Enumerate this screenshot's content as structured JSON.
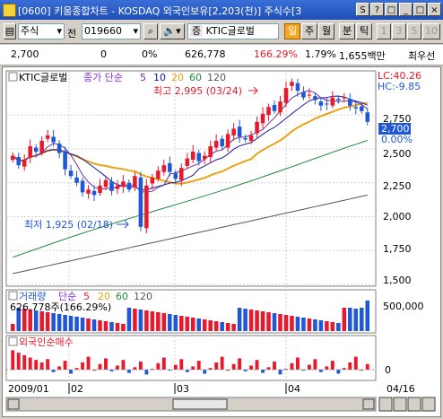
{
  "window": {
    "title": "[0600] 키움종합차트 - KOSDAQ 외국인보유[2,203(천)] 주식수[3",
    "buttons": [
      "S",
      "?",
      "□",
      "_",
      "□",
      "×"
    ]
  },
  "toolbar": {
    "market_label": "주식",
    "prev_label": "전",
    "code_value": "019660",
    "search_icon": "search-icon",
    "speaker_icon": "speaker-icon",
    "stock_badge": "증",
    "stock_name": "KTIC글로벌",
    "periods": [
      "일",
      "주",
      "월",
      "분",
      "틱"
    ],
    "active_period": "일",
    "intervals": [
      "1",
      "3",
      "5",
      "10"
    ]
  },
  "info": {
    "price": "2,700",
    "change": "0",
    "change_pct": "0%",
    "volume": "626,778",
    "volume_ratio": "166.29%",
    "turnover": "1.79%",
    "amount": "1,655백만",
    "priority": "최우선"
  },
  "price_panel": {
    "legend_name": "KTIC글로벌",
    "legend_ma_label": "종가 단순",
    "legend_ma": [
      "5",
      "10",
      "20",
      "60",
      "120"
    ],
    "lc_label": "LC:40.26",
    "hc_label": "HC:-9.85",
    "high_label": "최고 2,995 (03/24)",
    "low_label": "최저 1,925 (02/18)",
    "current_tag": "2,700",
    "current_pct": "0.00%",
    "y_ticks": [
      "2,750",
      "2,500",
      "2,250",
      "2,000",
      "1,750",
      "1,500"
    ]
  },
  "volume_panel": {
    "title": "거래량",
    "legend_ma_label": "단순",
    "legend_ma": [
      "5",
      "20",
      "60",
      "120"
    ],
    "value_label": "626,778주(166.29%)",
    "y_ticks": [
      "500,000"
    ]
  },
  "foreign_panel": {
    "title": "외국인순매수",
    "y_ticks": [
      "0"
    ]
  },
  "x_axis": {
    "labels": [
      "2009/01",
      "02",
      "03",
      "04"
    ],
    "right_label": "04/16"
  },
  "colors": {
    "up": "#e8192c",
    "down": "#1f57d6",
    "ma5": "#6b2fa0",
    "ma10": "#1a1a9a",
    "ma20": "#e8a317",
    "ma60": "#1f8a3a",
    "ma120": "#555555"
  },
  "chart_data": {
    "type": "candlestick",
    "title": "KTIC글로벌 일봉",
    "y_range": [
      1500,
      3050
    ],
    "ohlc_close": [
      2450,
      2380,
      2420,
      2520,
      2480,
      2560,
      2600,
      2550,
      2470,
      2350,
      2300,
      2250,
      2180,
      2200,
      2160,
      2230,
      2270,
      2190,
      2230,
      2260,
      2200,
      2300,
      1925,
      2230,
      2290,
      2340,
      2380,
      2330,
      2280,
      2360,
      2430,
      2480,
      2410,
      2450,
      2520,
      2560,
      2520,
      2610,
      2650,
      2590,
      2570,
      2600,
      2700,
      2760,
      2810,
      2780,
      2850,
      2950,
      2995,
      2930,
      2880,
      2900,
      2860,
      2820,
      2830,
      2880,
      2860,
      2880,
      2820,
      2800,
      2780,
      2700
    ],
    "high_point": {
      "label": "최고",
      "value": 2995,
      "date": "03/24"
    },
    "low_point": {
      "label": "최저",
      "value": 1925,
      "date": "02/18"
    },
    "current": 2700
  }
}
